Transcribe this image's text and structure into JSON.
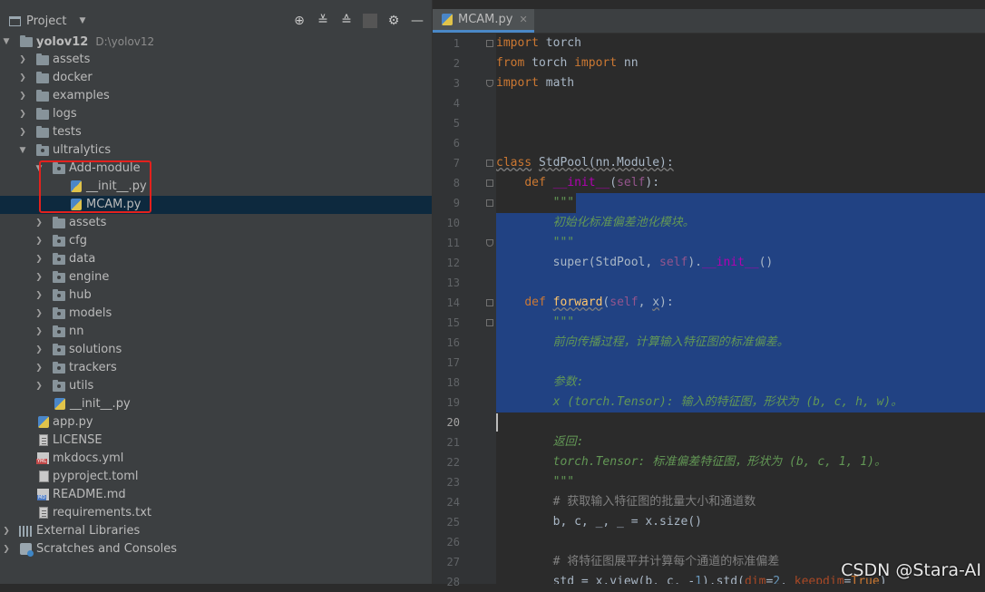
{
  "project_panel": {
    "title": "Project",
    "tree": [
      {
        "label": "yolov12",
        "path": "D:\\yolov12"
      },
      {
        "label": "assets"
      },
      {
        "label": "docker"
      },
      {
        "label": "examples"
      },
      {
        "label": "logs"
      },
      {
        "label": "tests"
      },
      {
        "label": "ultralytics"
      },
      {
        "label": "Add-module"
      },
      {
        "label": "__init__.py"
      },
      {
        "label": "MCAM.py"
      },
      {
        "label": "assets"
      },
      {
        "label": "cfg"
      },
      {
        "label": "data"
      },
      {
        "label": "engine"
      },
      {
        "label": "hub"
      },
      {
        "label": "models"
      },
      {
        "label": "nn"
      },
      {
        "label": "solutions"
      },
      {
        "label": "trackers"
      },
      {
        "label": "utils"
      },
      {
        "label": "__init__.py"
      },
      {
        "label": "app.py"
      },
      {
        "label": "LICENSE"
      },
      {
        "label": "mkdocs.yml"
      },
      {
        "label": "pyproject.toml"
      },
      {
        "label": "README.md"
      },
      {
        "label": "requirements.txt"
      },
      {
        "label": "External Libraries"
      },
      {
        "label": "Scratches and Consoles"
      }
    ]
  },
  "editor": {
    "tab_label": "MCAM.py",
    "line_numbers": [
      "1",
      "2",
      "3",
      "4",
      "5",
      "6",
      "7",
      "8",
      "9",
      "10",
      "11",
      "12",
      "13",
      "14",
      "15",
      "16",
      "17",
      "18",
      "19",
      "20",
      "21",
      "22",
      "23",
      "24",
      "25",
      "26",
      "27",
      "28"
    ],
    "current_line": "20"
  },
  "watermark": "CSDN @Stara-AI",
  "colors": {
    "panel_bg": "#3c3f41",
    "editor_bg": "#2b2b2b",
    "selection_bg": "#214283",
    "tree_selected_bg": "#0d293e",
    "highlight_box": "#e3211d",
    "keyword": "#cc7832",
    "docstring": "#629755"
  },
  "icons": {
    "header_tools": [
      "target-icon",
      "expand-all-icon",
      "collapse-all-icon",
      "gear-icon",
      "minimize-icon"
    ]
  }
}
